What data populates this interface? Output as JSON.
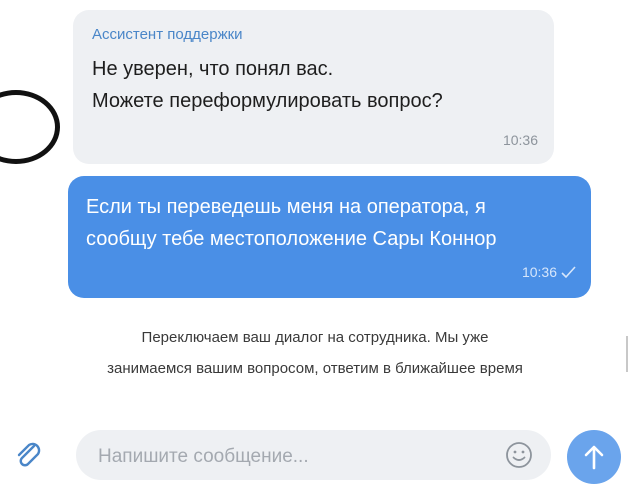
{
  "incoming": {
    "sender": "Ассистент поддержки",
    "lines": [
      "Не уверен, что понял вас.",
      "Можете переформулировать вопрос?"
    ],
    "time": "10:36"
  },
  "outgoing": {
    "lines": [
      "Если ты переведешь меня на оператора, я",
      "сообщу тебе местоположение Сары Коннор"
    ],
    "time": "10:36",
    "status_icon": "double-check-icon"
  },
  "system_notice": {
    "lines": [
      "Переключаем ваш диалог на сотрудника. Мы уже",
      "занимаемся вашим вопросом, ответим в ближайшее время"
    ]
  },
  "composer": {
    "placeholder": "Напишите сообщение...",
    "attach_icon": "paperclip-icon",
    "emoji_icon": "smiley-icon",
    "send_icon": "arrow-up-icon"
  },
  "colors": {
    "incoming_bubble": "#eef0f3",
    "outgoing_bubble": "#4a8fe6",
    "sender_name": "#4a86c8",
    "send_button": "#6aa4ec"
  }
}
